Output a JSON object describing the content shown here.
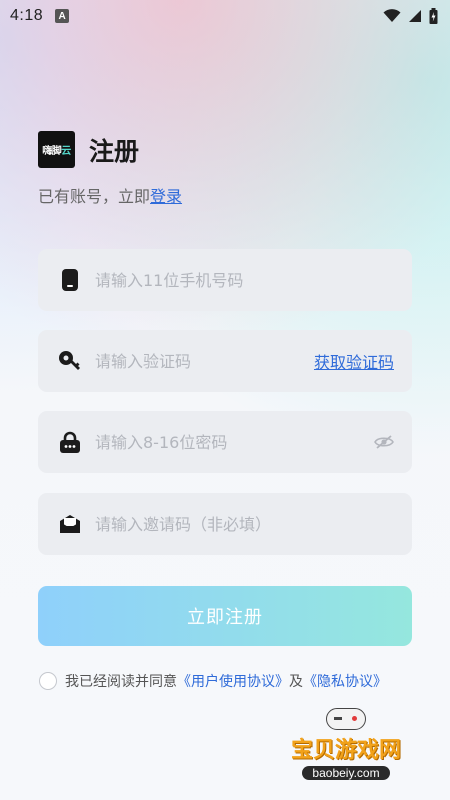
{
  "status_bar": {
    "time": "4:18",
    "app_badge": "A"
  },
  "brand": {
    "logo_text_main": "嗨",
    "logo_text_rest": "脚",
    "logo_text_accent": "云",
    "logo_accent_color": "#55d6c9"
  },
  "page": {
    "title": "注册",
    "login_prompt": "已有账号，立即",
    "login_link": "登录"
  },
  "fields": {
    "phone": {
      "placeholder": "请输入11位手机号码",
      "value": ""
    },
    "code": {
      "placeholder": "请输入验证码",
      "value": "",
      "action_label": "获取验证码"
    },
    "password": {
      "placeholder": "请输入8-16位密码",
      "value": ""
    },
    "invite": {
      "placeholder": "请输入邀请码（非必填）",
      "value": ""
    }
  },
  "register_button": {
    "label": "立即注册",
    "gradient_start": "#8fd0fb",
    "gradient_end": "#95e7de"
  },
  "agreement": {
    "prefix": "我已经阅读并同意",
    "user_agreement": "《用户使用协议》",
    "conjunction": "及",
    "privacy": "《隐私协议》",
    "checked": false
  },
  "watermark": {
    "title": "宝贝游戏网",
    "url": "baobeiy.com"
  },
  "colors": {
    "link": "#2f6bd9",
    "field_bg": "#ebedf1",
    "placeholder": "#b3b6bd"
  }
}
